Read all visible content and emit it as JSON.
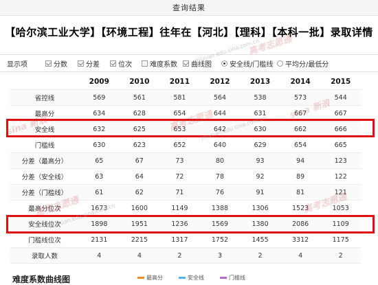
{
  "header": {
    "title": "查询结果"
  },
  "main_title": "【哈尔滨工业大学】【环境工程】往年在【河北】【理科】【本科一批】录取详情",
  "options": {
    "label": "显示项",
    "items": [
      {
        "label": "分数",
        "type": "checkbox",
        "checked": true
      },
      {
        "label": "分差",
        "type": "checkbox",
        "checked": true
      },
      {
        "label": "位次",
        "type": "checkbox",
        "checked": true
      },
      {
        "label": "难度系数",
        "type": "checkbox",
        "checked": false
      },
      {
        "label": "曲线图",
        "type": "checkbox",
        "checked": true
      },
      {
        "label": "安全线/门槛线",
        "type": "radio",
        "checked": true
      },
      {
        "label": "平均分/最低分",
        "type": "radio",
        "checked": false
      }
    ]
  },
  "table": {
    "years": [
      "2009",
      "2010",
      "2011",
      "2012",
      "2013",
      "2014",
      "2015"
    ],
    "rows": [
      {
        "label": "省控线",
        "values": [
          "569",
          "561",
          "581",
          "564",
          "538",
          "573",
          "544"
        ]
      },
      {
        "label": "最高分",
        "values": [
          "634",
          "628",
          "654",
          "644",
          "631",
          "667",
          "667"
        ]
      },
      {
        "label": "安全线",
        "values": [
          "632",
          "625",
          "653",
          "642",
          "630",
          "662",
          "666"
        ]
      },
      {
        "label": "门槛线",
        "values": [
          "630",
          "623",
          "652",
          "640",
          "629",
          "654",
          "665"
        ]
      },
      {
        "label": "分差（最高分）",
        "values": [
          "65",
          "67",
          "73",
          "80",
          "93",
          "94",
          "123"
        ]
      },
      {
        "label": "分差（安全线）",
        "values": [
          "63",
          "64",
          "72",
          "78",
          "92",
          "89",
          "122"
        ]
      },
      {
        "label": "分差（门槛线）",
        "values": [
          "61",
          "62",
          "71",
          "76",
          "91",
          "81",
          "121"
        ]
      },
      {
        "label": "最高分位次",
        "values": [
          "1673",
          "1600",
          "1149",
          "1388",
          "1306",
          "1523",
          "1053"
        ]
      },
      {
        "label": "安全线位次",
        "values": [
          "1898",
          "1951",
          "1236",
          "1569",
          "1380",
          "2086",
          "1109"
        ]
      },
      {
        "label": "门槛线位次",
        "values": [
          "2131",
          "2215",
          "1317",
          "1752",
          "1455",
          "3312",
          "1175"
        ]
      },
      {
        "label": "录取人数",
        "values": [
          "4",
          "4",
          "2",
          "3",
          "2",
          "4",
          "2"
        ]
      }
    ]
  },
  "bottom": {
    "title": "难度系数曲线图",
    "legend": [
      {
        "label": "最高分",
        "color": "#f28c28"
      },
      {
        "label": "安全线",
        "color": "#4fb3e8"
      },
      {
        "label": "门槛线",
        "color": "#b06cc8"
      }
    ]
  },
  "watermark": {
    "brand": "sina 新浪",
    "text": "高考志愿通",
    "url": "zhiyuan.edu.sina.com.cn"
  },
  "colors": {
    "highlight": "#e01010"
  }
}
